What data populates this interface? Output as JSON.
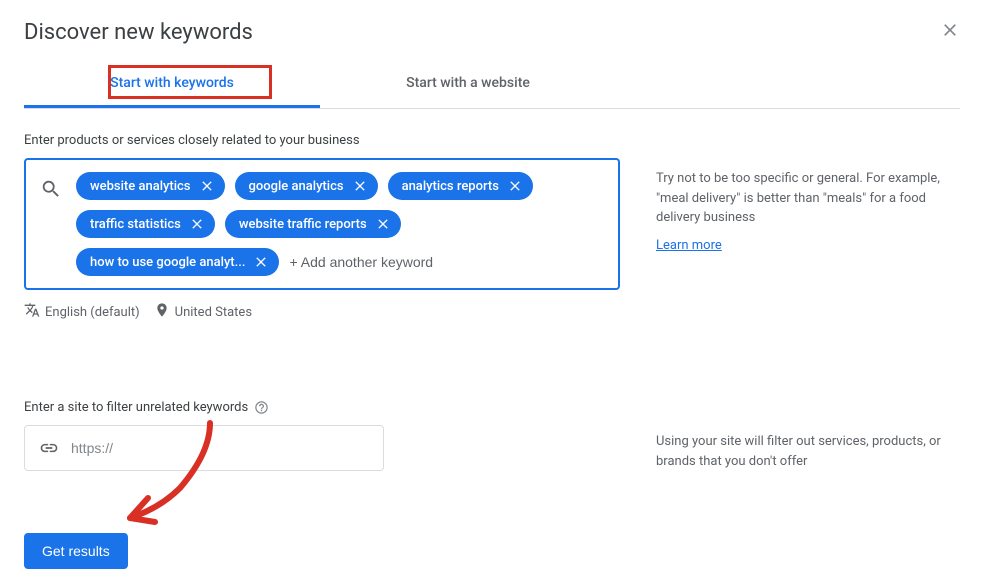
{
  "page_title": "Discover new keywords",
  "tabs": {
    "keywords": "Start with keywords",
    "website": "Start with a website"
  },
  "keywords_section": {
    "label": "Enter products or services closely related to your business",
    "chips": [
      "website analytics",
      "google analytics",
      "analytics reports",
      "traffic statistics",
      "website traffic reports",
      "how to use google analyt..."
    ],
    "add_placeholder": "+ Add another keyword",
    "helper_text": "Try not to be too specific or general. For example, \"meal delivery\" is better than \"meals\" for a food delivery business",
    "learn_more": "Learn more"
  },
  "locale": {
    "language": "English (default)",
    "location": "United States"
  },
  "site_section": {
    "label": "Enter a site to filter unrelated keywords",
    "placeholder": "https://",
    "helper_text": "Using your site will filter out services, products, or brands that you don't offer"
  },
  "get_results_label": "Get results"
}
